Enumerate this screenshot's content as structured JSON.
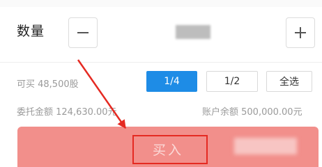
{
  "quantity": {
    "label": "数量",
    "minus_symbol": "−",
    "plus_symbol": "+"
  },
  "info": {
    "can_buy": "可买 48,500股",
    "order_amount": "委托金额 124,630.00元",
    "account_balance": "账户余额 500,000.00元"
  },
  "fractions": [
    {
      "label": "1/4",
      "active": true
    },
    {
      "label": "1/2",
      "active": false
    },
    {
      "label": "全选",
      "active": false
    }
  ],
  "buy": {
    "label": "买入"
  },
  "colors": {
    "accent_blue": "#1e8ce6",
    "buy_button": "#f28f8b",
    "annotation_red": "#e52a22"
  }
}
